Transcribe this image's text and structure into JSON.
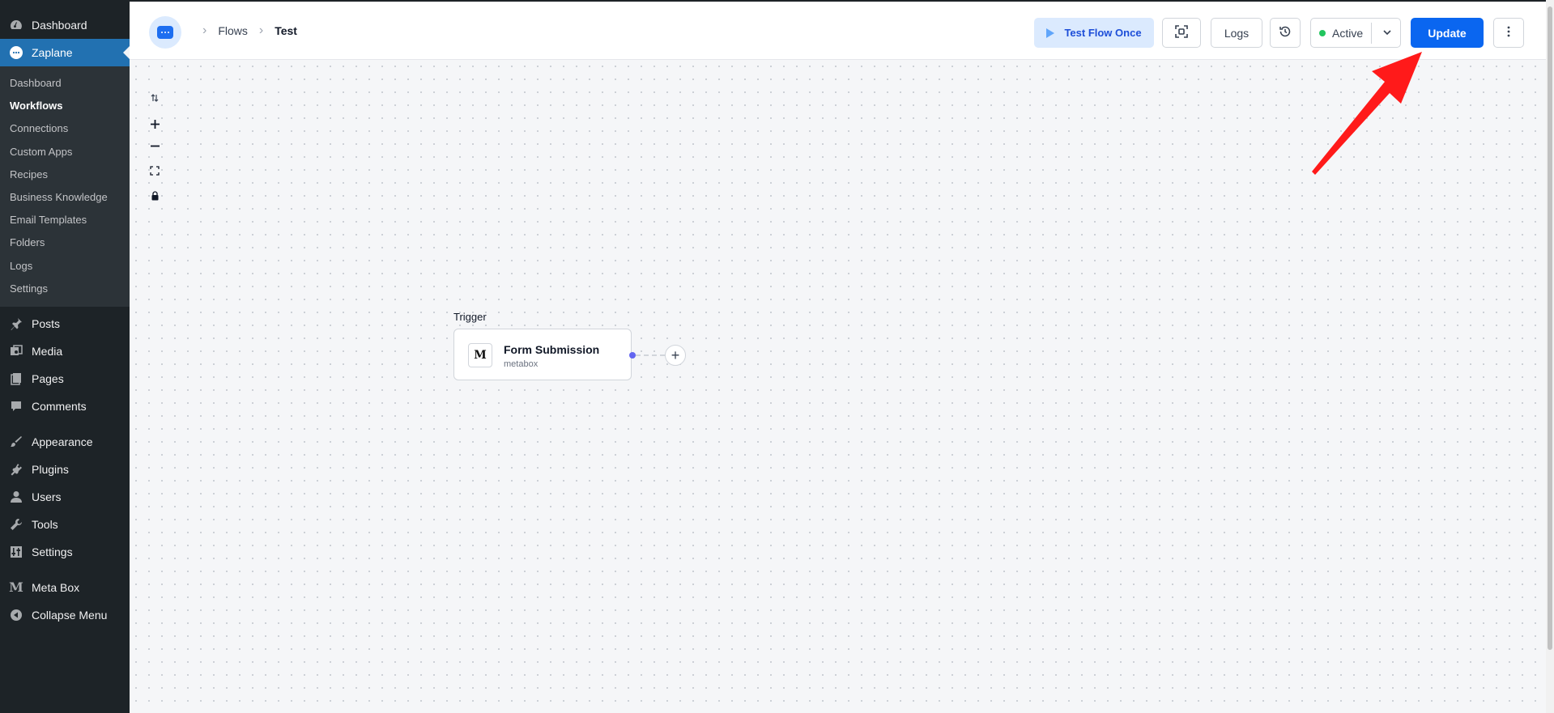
{
  "sidebar": {
    "top": [
      {
        "label": "Dashboard",
        "icon": "dashboard-icon"
      },
      {
        "label": "Zaplane",
        "icon": "zaplane-icon"
      }
    ],
    "submenu": [
      "Dashboard",
      "Workflows",
      "Connections",
      "Custom Apps",
      "Recipes",
      "Business Knowledge",
      "Email Templates",
      "Folders",
      "Logs",
      "Settings"
    ],
    "menu": [
      {
        "label": "Posts",
        "icon": "pin-icon"
      },
      {
        "label": "Media",
        "icon": "media-icon"
      },
      {
        "label": "Pages",
        "icon": "pages-icon"
      },
      {
        "label": "Comments",
        "icon": "comment-icon"
      },
      {
        "label": "Appearance",
        "icon": "brush-icon"
      },
      {
        "label": "Plugins",
        "icon": "plugin-icon"
      },
      {
        "label": "Users",
        "icon": "user-icon"
      },
      {
        "label": "Tools",
        "icon": "wrench-icon"
      },
      {
        "label": "Settings",
        "icon": "settings-icon"
      },
      {
        "label": "Meta Box",
        "icon": "metabox-icon"
      },
      {
        "label": "Collapse Menu",
        "icon": "collapse-icon"
      }
    ]
  },
  "header": {
    "breadcrumb": {
      "flows": "Flows",
      "current": "Test"
    },
    "test_flow_label": "Test Flow Once",
    "logs_label": "Logs",
    "status_label": "Active",
    "update_label": "Update"
  },
  "canvas": {
    "trigger_label": "Trigger",
    "node": {
      "title": "Form Submission",
      "subtitle": "metabox",
      "icon_letter": "M"
    }
  },
  "colors": {
    "sidebar_bg": "#1d2327",
    "submenu_bg": "#2c3338",
    "active_menu": "#2271b1",
    "primary": "#0a66f0",
    "status_green": "#22c55e",
    "annotation_arrow": "#ff1a1a"
  }
}
